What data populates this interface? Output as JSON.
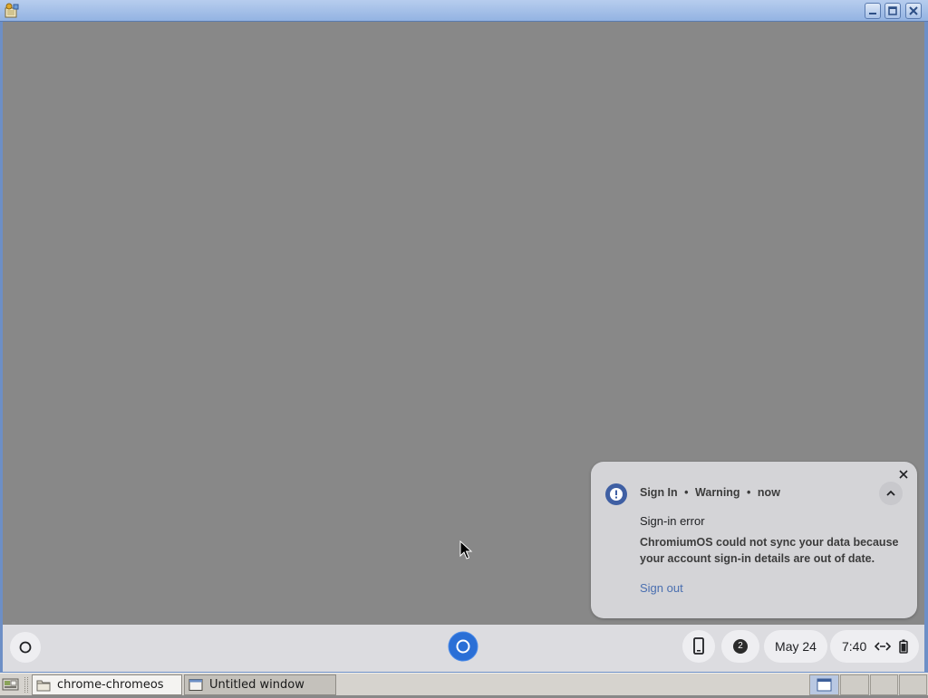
{
  "notification": {
    "source": "Sign In",
    "severity": "Warning",
    "time": "now",
    "separator": "•",
    "title": "Sign-in error",
    "body": "ChromiumOS could not sync your data because your account sign-in details are out of date.",
    "action_label": "Sign out",
    "accent_color": "#3f5fa3"
  },
  "shelf": {
    "notification_count": "2",
    "date": "May 24",
    "time": "7:40"
  },
  "taskbar": {
    "tasks": [
      {
        "label": "chrome-chromeos",
        "icon": "folder-icon"
      },
      {
        "label": "Untitled window",
        "icon": "window-icon"
      }
    ]
  },
  "colors": {
    "desktop": "#888888",
    "titlebar": "#a7c1ea",
    "notification_bg": "#d4d4d7",
    "link": "#4a6fb0"
  }
}
